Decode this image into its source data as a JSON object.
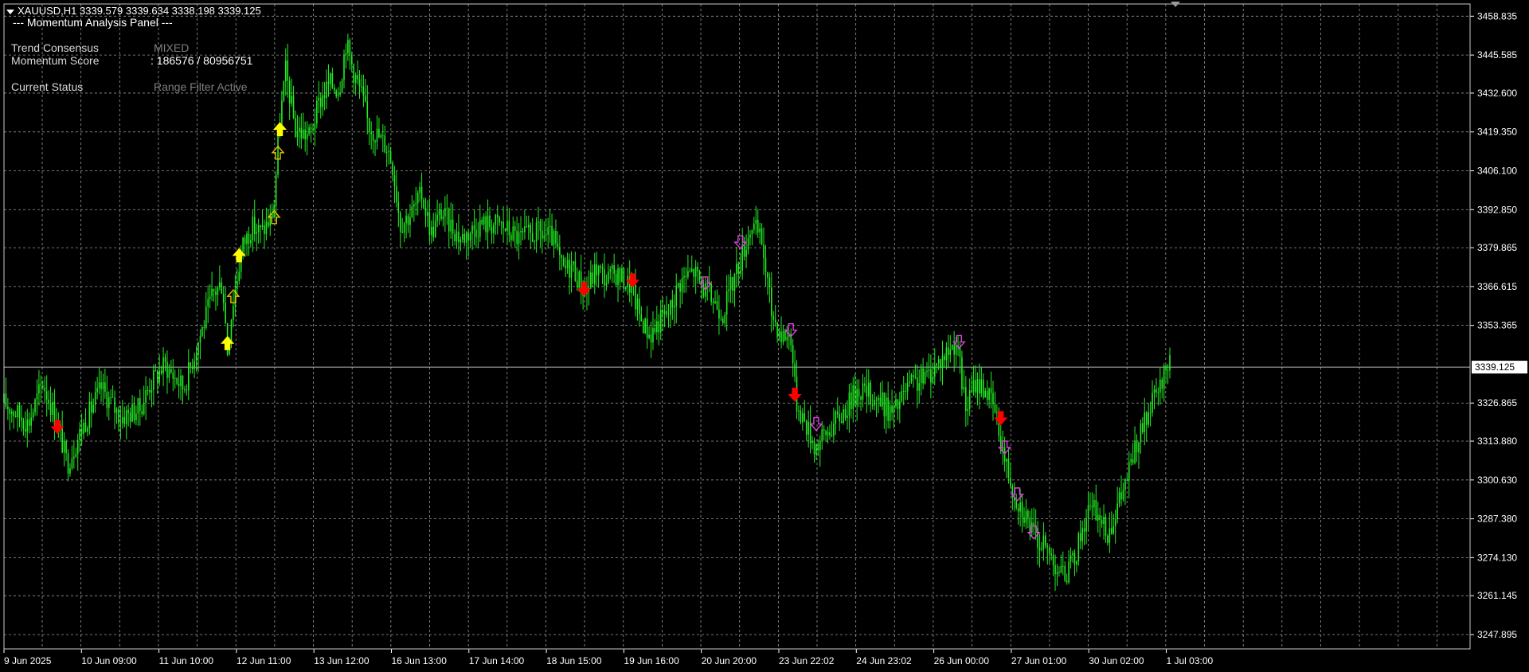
{
  "header": {
    "symbol_line": "XAUUSD,H1  3339.579 3339.634 3338.198 3339.125",
    "panel_title": "--- Momentum Analysis Panel ---"
  },
  "panel": {
    "trend_label": "Trend Consensus",
    "trend_value": "MIXED",
    "momentum_label": "Momentum Score",
    "momentum_value": ": 186576 / 80956751",
    "status_label": "Current Status",
    "status_value": "Range Filter Active"
  },
  "colors": {
    "background": "#000000",
    "grid": "#9a9a9a",
    "candles": "#22ee22",
    "arrow_up_solid": "#ffff00",
    "arrow_up_hollow": "#e8c400",
    "arrow_down_solid": "#ff0000",
    "arrow_down_hollow": "#e040e0"
  },
  "chart_data": {
    "type": "candlestick",
    "symbol": "XAUUSD",
    "timeframe": "H1",
    "current_price": 3339.125,
    "current_price_label": "3339.125",
    "ylim": [
      3243.0,
      3463.0
    ],
    "y_ticks": [
      3458.835,
      3445.585,
      3432.6,
      3419.35,
      3406.1,
      3392.85,
      3379.865,
      3366.615,
      3353.365,
      3326.865,
      3313.88,
      3300.63,
      3287.38,
      3274.13,
      3261.145,
      3247.895
    ],
    "y_tick_labels": [
      "3458.835",
      "3445.585",
      "3432.600",
      "3419.350",
      "3406.100",
      "3392.850",
      "3379.865",
      "3366.615",
      "3353.365",
      "3326.865",
      "3313.880",
      "3300.630",
      "3287.380",
      "3274.130",
      "3261.145",
      "3247.895"
    ],
    "x_tick_labels": [
      "9 Jun 2025",
      "10 Jun 09:00",
      "11 Jun 10:00",
      "12 Jun 11:00",
      "13 Jun 12:00",
      "16 Jun 13:00",
      "17 Jun 14:00",
      "18 Jun 15:00",
      "19 Jun 16:00",
      "20 Jun 20:00",
      "23 Jun 22:02",
      "24 Jun 23:02",
      "26 Jun 00:00",
      "27 Jun 01:00",
      "30 Jun 02:00",
      "1 Jul 03:00"
    ],
    "price_path": [
      [
        0,
        3327
      ],
      [
        25,
        3320
      ],
      [
        40,
        3334
      ],
      [
        55,
        3320
      ],
      [
        65,
        3306
      ],
      [
        80,
        3318
      ],
      [
        100,
        3332
      ],
      [
        120,
        3322
      ],
      [
        140,
        3325
      ],
      [
        150,
        3333
      ],
      [
        165,
        3340
      ],
      [
        185,
        3332
      ],
      [
        200,
        3348
      ],
      [
        215,
        3364
      ],
      [
        225,
        3368
      ],
      [
        230,
        3345
      ],
      [
        235,
        3360
      ],
      [
        245,
        3380
      ],
      [
        255,
        3387
      ],
      [
        265,
        3385
      ],
      [
        275,
        3390
      ],
      [
        278,
        3395
      ],
      [
        283,
        3420
      ],
      [
        290,
        3440
      ],
      [
        300,
        3420
      ],
      [
        315,
        3418
      ],
      [
        325,
        3430
      ],
      [
        335,
        3436
      ],
      [
        345,
        3434
      ],
      [
        352,
        3450
      ],
      [
        360,
        3440
      ],
      [
        368,
        3432
      ],
      [
        375,
        3422
      ],
      [
        385,
        3418
      ],
      [
        395,
        3414
      ],
      [
        400,
        3408
      ],
      [
        408,
        3388
      ],
      [
        420,
        3392
      ],
      [
        430,
        3398
      ],
      [
        440,
        3385
      ],
      [
        450,
        3392
      ],
      [
        470,
        3383
      ],
      [
        490,
        3388
      ],
      [
        510,
        3388
      ],
      [
        530,
        3383
      ],
      [
        550,
        3385
      ],
      [
        565,
        3383
      ],
      [
        575,
        3372
      ],
      [
        585,
        3374
      ],
      [
        598,
        3364
      ],
      [
        610,
        3373
      ],
      [
        620,
        3369
      ],
      [
        630,
        3371
      ],
      [
        645,
        3367
      ],
      [
        655,
        3356
      ],
      [
        665,
        3350
      ],
      [
        675,
        3355
      ],
      [
        685,
        3358
      ],
      [
        695,
        3368
      ],
      [
        710,
        3372
      ],
      [
        720,
        3366
      ],
      [
        730,
        3362
      ],
      [
        740,
        3358
      ],
      [
        750,
        3368
      ],
      [
        760,
        3378
      ],
      [
        770,
        3388
      ],
      [
        780,
        3382
      ],
      [
        790,
        3358
      ],
      [
        800,
        3350
      ],
      [
        810,
        3350
      ],
      [
        815,
        3328
      ],
      [
        825,
        3320
      ],
      [
        835,
        3312
      ],
      [
        845,
        3316
      ],
      [
        860,
        3322
      ],
      [
        880,
        3332
      ],
      [
        900,
        3328
      ],
      [
        915,
        3323
      ],
      [
        930,
        3332
      ],
      [
        950,
        3336
      ],
      [
        970,
        3344
      ],
      [
        980,
        3348
      ],
      [
        990,
        3325
      ],
      [
        1000,
        3334
      ],
      [
        1010,
        3332
      ],
      [
        1020,
        3324
      ],
      [
        1030,
        3308
      ],
      [
        1040,
        3296
      ],
      [
        1050,
        3290
      ],
      [
        1060,
        3282
      ],
      [
        1075,
        3276
      ],
      [
        1090,
        3268
      ],
      [
        1100,
        3272
      ],
      [
        1115,
        3290
      ],
      [
        1125,
        3290
      ],
      [
        1135,
        3282
      ],
      [
        1150,
        3295
      ],
      [
        1165,
        3312
      ],
      [
        1180,
        3325
      ],
      [
        1190,
        3332
      ],
      [
        1200,
        3342
      ]
    ],
    "signals": [
      {
        "type": "down",
        "style": "solid",
        "x": 55,
        "price": 3319
      },
      {
        "type": "up",
        "style": "solid",
        "x": 230,
        "price": 3347
      },
      {
        "type": "up",
        "style": "hollow",
        "x": 236,
        "price": 3363
      },
      {
        "type": "up",
        "style": "solid",
        "x": 242,
        "price": 3377
      },
      {
        "type": "up",
        "style": "hollow",
        "x": 278,
        "price": 3390
      },
      {
        "type": "up",
        "style": "hollow",
        "x": 282,
        "price": 3412
      },
      {
        "type": "up",
        "style": "solid",
        "x": 284,
        "price": 3420
      },
      {
        "type": "down",
        "style": "solid",
        "x": 597,
        "price": 3366
      },
      {
        "type": "down",
        "style": "solid",
        "x": 647,
        "price": 3369
      },
      {
        "type": "down",
        "style": "hollow",
        "x": 722,
        "price": 3368
      },
      {
        "type": "down",
        "style": "hollow",
        "x": 758,
        "price": 3382
      },
      {
        "type": "down",
        "style": "hollow",
        "x": 810,
        "price": 3352
      },
      {
        "type": "down",
        "style": "solid",
        "x": 814,
        "price": 3330
      },
      {
        "type": "down",
        "style": "hollow",
        "x": 836,
        "price": 3320
      },
      {
        "type": "down",
        "style": "hollow",
        "x": 983,
        "price": 3348
      },
      {
        "type": "down",
        "style": "solid",
        "x": 1026,
        "price": 3322
      },
      {
        "type": "down",
        "style": "hollow",
        "x": 1030,
        "price": 3312
      },
      {
        "type": "down",
        "style": "hollow",
        "x": 1043,
        "price": 3296
      },
      {
        "type": "down",
        "style": "hollow",
        "x": 1060,
        "price": 3283
      }
    ]
  }
}
